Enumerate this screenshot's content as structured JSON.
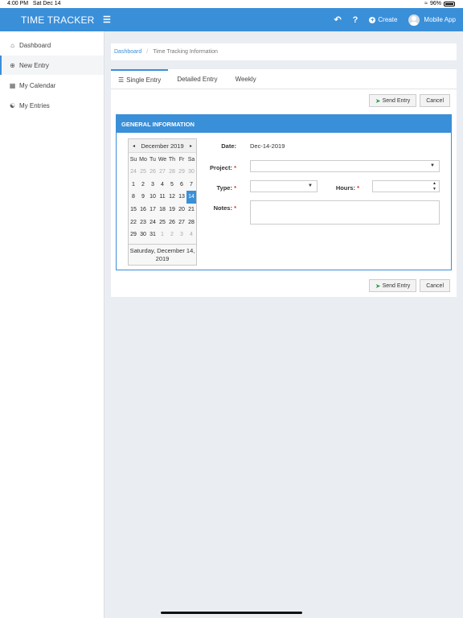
{
  "status_bar": {
    "time": "4:00 PM",
    "date": "Sat Dec 14",
    "battery": "96%"
  },
  "navbar": {
    "brand": "TIME TRACKER",
    "menu_icon": "hamburger-icon",
    "back_icon": "undo-arrow-icon",
    "help_label": "?",
    "create_label": "Create",
    "user_label": "Mobile App",
    "accent_color": "#3a8fd9"
  },
  "sidebar": {
    "items": [
      {
        "label": "Dashboard",
        "icon": "home-icon"
      },
      {
        "label": "New Entry",
        "icon": "plus-circle-icon",
        "active": true
      },
      {
        "label": "My Calendar",
        "icon": "calendar-icon"
      },
      {
        "label": "My Entries",
        "icon": "user-icon"
      }
    ]
  },
  "breadcrumb": {
    "home": "Dashboard",
    "current": "Time Tracking Information"
  },
  "tabs": [
    {
      "label": "Single Entry",
      "active": true
    },
    {
      "label": "Detailed Entry"
    },
    {
      "label": "Weekly"
    }
  ],
  "actions": {
    "send_label": "Send Entry",
    "cancel_label": "Cancel"
  },
  "section_title": "GENERAL INFORMATION",
  "calendar": {
    "month_label": "December 2019",
    "prev_symbol": "◂",
    "next_symbol": "▸",
    "day_names": [
      "Su",
      "Mo",
      "Tu",
      "We",
      "Th",
      "Fr",
      "Sa"
    ],
    "weeks": [
      [
        "24",
        "25",
        "26",
        "27",
        "28",
        "29",
        "30"
      ],
      [
        "1",
        "2",
        "3",
        "4",
        "5",
        "6",
        "7"
      ],
      [
        "8",
        "9",
        "10",
        "11",
        "12",
        "13",
        "14"
      ],
      [
        "15",
        "16",
        "17",
        "18",
        "19",
        "20",
        "21"
      ],
      [
        "22",
        "23",
        "24",
        "25",
        "26",
        "27",
        "28"
      ],
      [
        "29",
        "30",
        "31",
        "1",
        "2",
        "3",
        "4"
      ]
    ],
    "selected_day": "14",
    "footer_line1": "Saturday, December 14,",
    "footer_line2": "2019"
  },
  "form": {
    "date_label": "Date:",
    "date_value": "Dec-14-2019",
    "project_label": "Project:",
    "project_value": "",
    "type_label": "Type:",
    "type_value": "",
    "hours_label": "Hours:",
    "hours_value": "",
    "notes_label": "Notes:",
    "notes_value": "",
    "required_mark": "*"
  }
}
